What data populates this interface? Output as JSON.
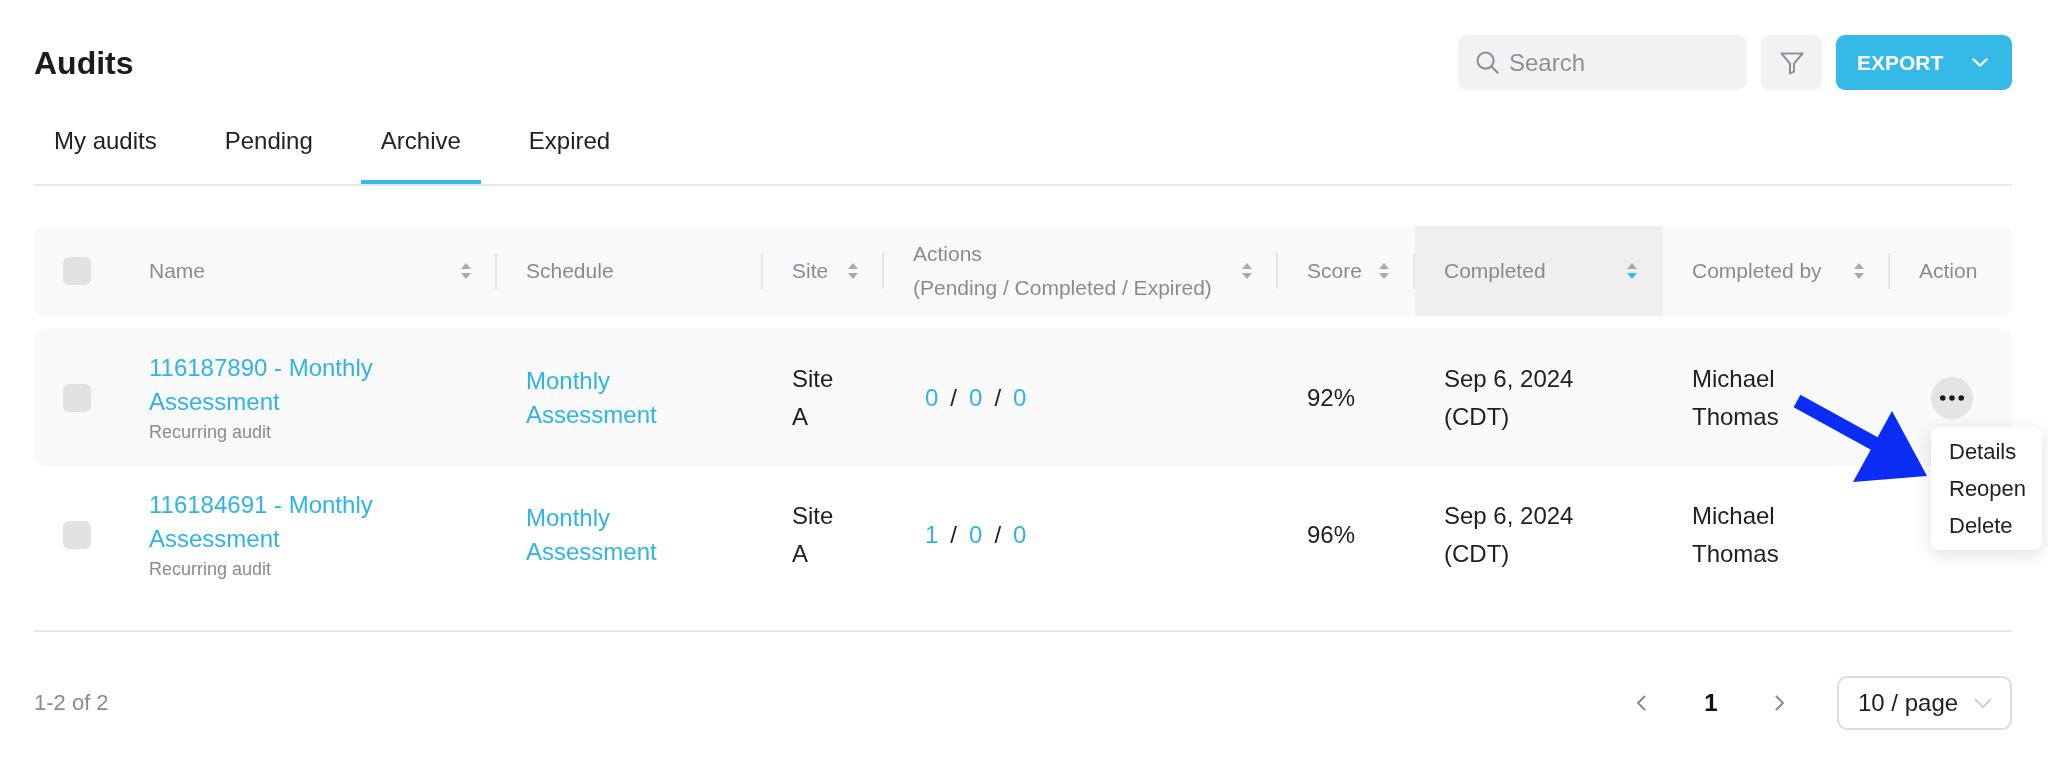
{
  "page": {
    "title": "Audits"
  },
  "search": {
    "placeholder": "Search"
  },
  "export_button": {
    "label": "EXPORT"
  },
  "tabs": [
    {
      "label": "My audits",
      "selected": false
    },
    {
      "label": "Pending",
      "selected": false
    },
    {
      "label": "Archive",
      "selected": true
    },
    {
      "label": "Expired",
      "selected": false
    }
  ],
  "table": {
    "select_all": {
      "checked": false
    },
    "columns": [
      {
        "label": "Name",
        "sortable": true,
        "sorted": false
      },
      {
        "label": "Schedule",
        "sortable": false
      },
      {
        "label": "Site",
        "sortable": true,
        "sorted": false
      },
      {
        "label": "Actions\n(Pending / Completed / Expired)",
        "sortable": true,
        "sorted": false
      },
      {
        "label": "Score",
        "sortable": true,
        "sorted": false
      },
      {
        "label": "Completed",
        "sortable": true,
        "sorted": true
      },
      {
        "label": "Completed by",
        "sortable": true,
        "sorted": false
      },
      {
        "label": "Action",
        "sortable": false
      }
    ],
    "rows": [
      {
        "checked": false,
        "hovered": true,
        "name": "116187890 - Monthly Assessment",
        "subtitle": "Recurring audit",
        "schedule": "Monthly Assessment",
        "site": "Site A",
        "action_counts": [
          {
            "kind": "count",
            "text": "0"
          },
          {
            "kind": "separator",
            "text": "/"
          },
          {
            "kind": "count",
            "text": "0"
          },
          {
            "kind": "separator",
            "text": "/"
          },
          {
            "kind": "count",
            "text": "0"
          }
        ],
        "score": "92%",
        "completed": "Sep 6, 2024 (CDT)",
        "completed_by": "Michael Thomas",
        "menu": {
          "open": true,
          "items": [
            {
              "label": "Details"
            },
            {
              "label": "Reopen"
            },
            {
              "label": "Delete"
            }
          ]
        }
      },
      {
        "checked": false,
        "hovered": false,
        "name": "116184691 - Monthly Assessment",
        "subtitle": "Recurring audit",
        "schedule": "Monthly Assessment",
        "site": "Site A",
        "action_counts": [
          {
            "kind": "count",
            "text": "1"
          },
          {
            "kind": "separator",
            "text": "/"
          },
          {
            "kind": "count",
            "text": "0"
          },
          {
            "kind": "separator",
            "text": "/"
          },
          {
            "kind": "count",
            "text": "0"
          }
        ],
        "score": "96%",
        "completed": "Sep 6, 2024 (CDT)",
        "completed_by": "Michael Thomas"
      }
    ]
  },
  "pagination": {
    "summary": "1-2 of 2",
    "pages": [
      {
        "label": "1",
        "selected": true
      }
    ],
    "page_size": "10 / page"
  }
}
